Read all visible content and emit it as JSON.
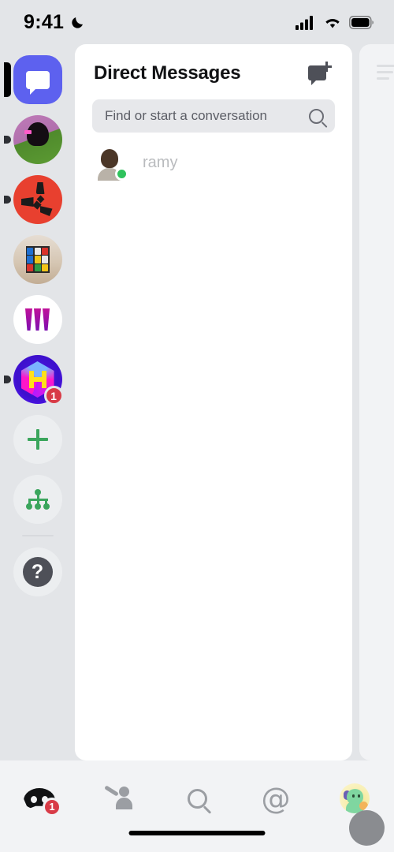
{
  "status_bar": {
    "time": "9:41",
    "dnd_icon": "crescent-moon-icon",
    "signal_icon": "cellular-signal-icon",
    "wifi_icon": "wifi-icon",
    "battery_icon": "battery-full-icon"
  },
  "server_rail": {
    "dm_button": {
      "name": "direct-messages-button",
      "icon": "speech-bubble-icon",
      "selected": true,
      "color": "#5d61ef"
    },
    "servers": [
      {
        "name": "server-icon-1",
        "unread": true,
        "badge": ""
      },
      {
        "name": "server-icon-2",
        "unread": true,
        "badge": ""
      },
      {
        "name": "server-icon-3",
        "unread": false,
        "badge": ""
      },
      {
        "name": "server-icon-4",
        "unread": false,
        "badge": ""
      },
      {
        "name": "server-icon-5",
        "unread": true,
        "badge": "1"
      }
    ],
    "actions": [
      {
        "name": "add-server-button",
        "icon": "plus-icon",
        "color": "#3aa55c"
      },
      {
        "name": "explore-servers-button",
        "icon": "compass-network-icon",
        "color": "#3aa55c"
      },
      {
        "name": "help-button",
        "icon": "question-mark-icon",
        "label": "?",
        "color": "#4e5058"
      }
    ]
  },
  "dm_panel": {
    "title": "Direct Messages",
    "new_dm_icon": "new-message-icon",
    "search": {
      "placeholder": "Find or start a conversation",
      "value": "",
      "icon": "search-icon"
    },
    "conversations": [
      {
        "username": "ramy",
        "status": "online",
        "status_color": "#2fc25c",
        "avatar": "user-avatar"
      }
    ]
  },
  "peek_panel": {
    "menu_icon": "hamburger-menu-icon"
  },
  "tab_bar": {
    "tabs": [
      {
        "name": "tab-servers",
        "icon": "discord-logo-icon",
        "active": true,
        "badge": "1"
      },
      {
        "name": "tab-friends",
        "icon": "friends-icon",
        "active": false,
        "badge": ""
      },
      {
        "name": "tab-search",
        "icon": "search-icon",
        "active": false,
        "badge": ""
      },
      {
        "name": "tab-mentions",
        "icon": "at-mention-icon",
        "label": "@",
        "active": false,
        "badge": ""
      },
      {
        "name": "tab-profile",
        "icon": "user-avatar-icon",
        "active": false,
        "badge": ""
      }
    ],
    "badge_color": "#d83b47"
  },
  "system": {
    "home_indicator": "home-indicator"
  }
}
